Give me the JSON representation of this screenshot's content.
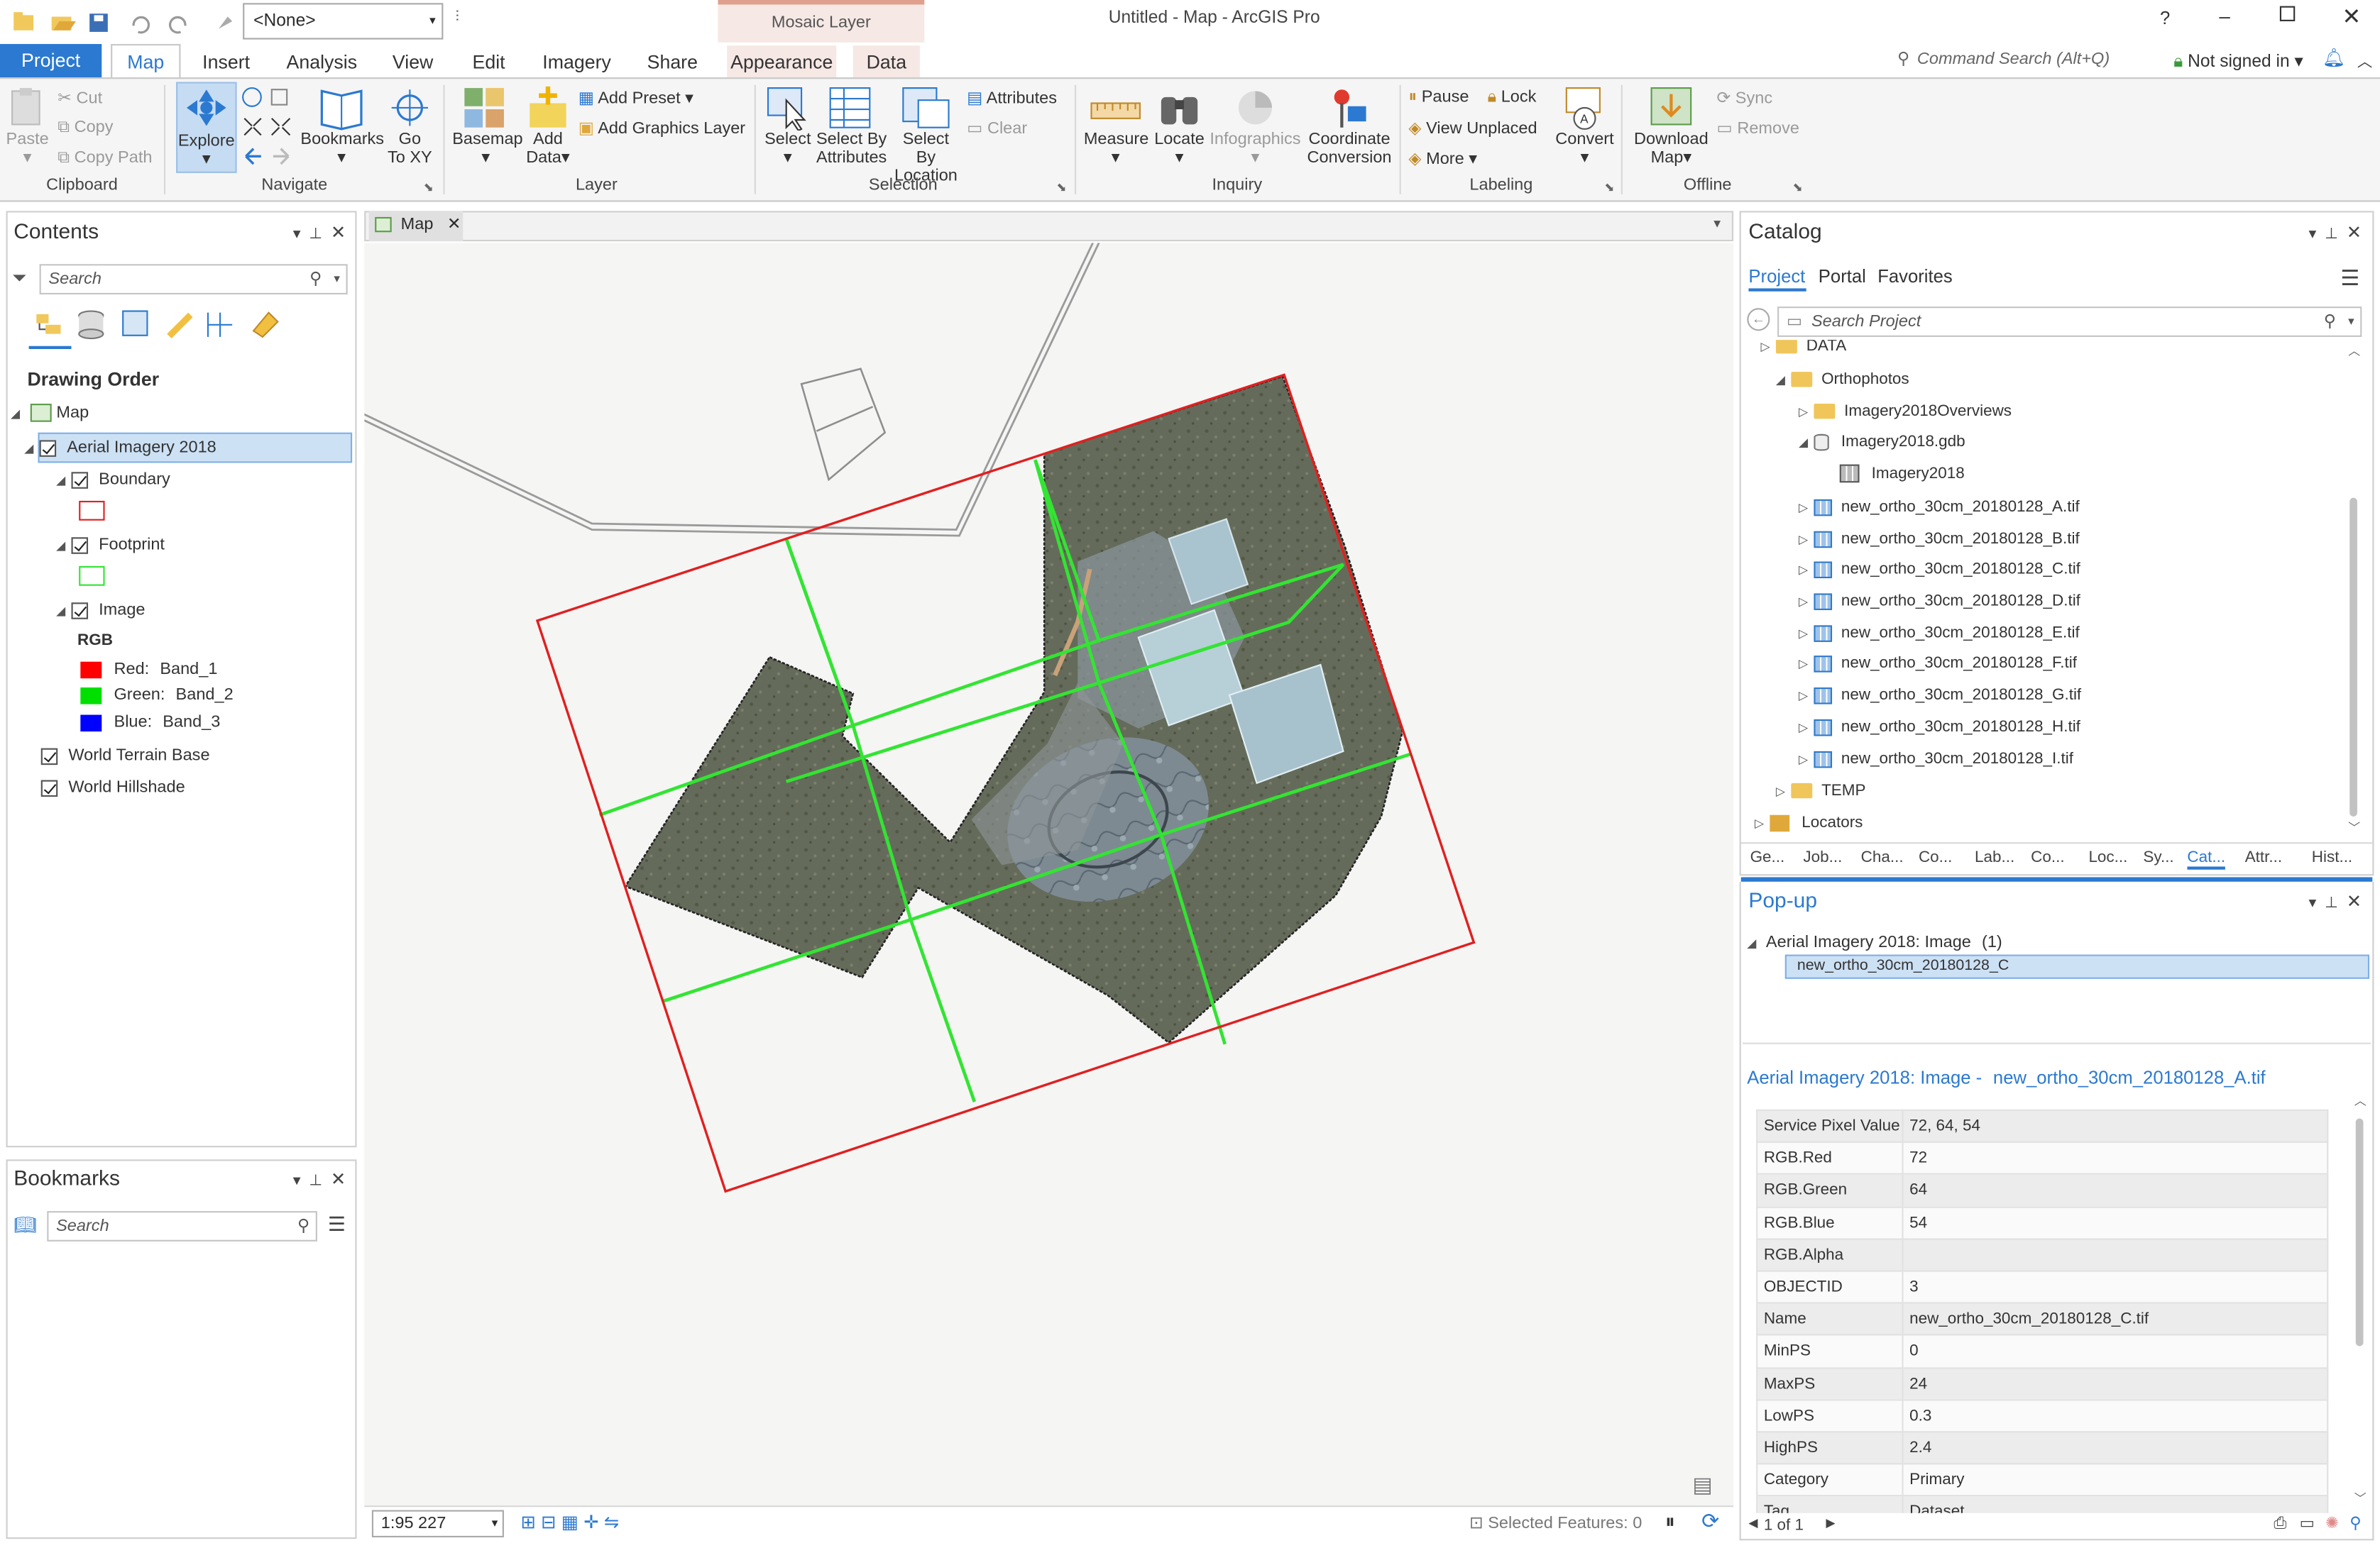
{
  "app": {
    "title": "Untitled - Map - ArcGIS Pro",
    "help": "?",
    "context_tab": "Mosaic Layer",
    "layer_select": "<None>",
    "command_search": "Command Search (Alt+Q)",
    "sign_in": "Not signed in"
  },
  "tabs": [
    "Project",
    "Map",
    "Insert",
    "Analysis",
    "View",
    "Edit",
    "Imagery",
    "Share",
    "Appearance",
    "Data"
  ],
  "ribbon": {
    "clipboard": {
      "label": "Clipboard",
      "paste": "Paste",
      "cut": "Cut",
      "copy": "Copy",
      "copy_path": "Copy Path"
    },
    "navigate": {
      "label": "Navigate",
      "explore": "Explore",
      "bookmarks": "Bookmarks",
      "goto1": "Go",
      "goto2": "To XY"
    },
    "layer": {
      "label": "Layer",
      "basemap": "Basemap",
      "add_data1": "Add",
      "add_data2": "Data",
      "add_preset": "Add Preset",
      "add_graphics": "Add Graphics Layer"
    },
    "selection": {
      "label": "Selection",
      "select": "Select",
      "sba1": "Select By",
      "sba2": "Attributes",
      "sbl1": "Select By",
      "sbl2": "Location",
      "attributes": "Attributes",
      "clear": "Clear"
    },
    "inquiry": {
      "label": "Inquiry",
      "measure": "Measure",
      "locate": "Locate",
      "infographics": "Infographics",
      "cc1": "Coordinate",
      "cc2": "Conversion"
    },
    "labeling": {
      "label": "Labeling",
      "pause": "Pause",
      "lock": "Lock",
      "view_unplaced": "View Unplaced",
      "more": "More",
      "convert": "Convert"
    },
    "offline": {
      "label": "Offline",
      "dl1": "Download",
      "dl2": "Map",
      "sync": "Sync",
      "remove": "Remove"
    }
  },
  "contents": {
    "title": "Contents",
    "search_placeholder": "Search",
    "drawing_order": "Drawing Order",
    "map": "Map",
    "layer": "Aerial Imagery 2018",
    "boundary": "Boundary",
    "footprint": "Footprint",
    "image": "Image",
    "rgb": "RGB",
    "red": "Red:",
    "red_band": "Band_1",
    "green": "Green:",
    "green_band": "Band_2",
    "blue": "Blue:",
    "blue_band": "Band_3",
    "terrain": "World Terrain Base",
    "hillshade": "World Hillshade"
  },
  "bookmarks": {
    "title": "Bookmarks",
    "search_placeholder": "Search"
  },
  "map_view": {
    "tab": "Map",
    "scale": "1:95 227",
    "selected_features": "Selected Features: 0"
  },
  "catalog": {
    "title": "Catalog",
    "tabs": [
      "Project",
      "Portal",
      "Favorites"
    ],
    "search_placeholder": "Search Project",
    "items": {
      "data": "DATA",
      "orthophotos": "Orthophotos",
      "overviews": "Imagery2018Overviews",
      "gdb": "Imagery2018.gdb",
      "mosaic": "Imagery2018",
      "temp": "TEMP",
      "locators": "Locators"
    },
    "tifs": [
      "new_ortho_30cm_20180128_A.tif",
      "new_ortho_30cm_20180128_B.tif",
      "new_ortho_30cm_20180128_C.tif",
      "new_ortho_30cm_20180128_D.tif",
      "new_ortho_30cm_20180128_E.tif",
      "new_ortho_30cm_20180128_F.tif",
      "new_ortho_30cm_20180128_G.tif",
      "new_ortho_30cm_20180128_H.tif",
      "new_ortho_30cm_20180128_I.tif"
    ],
    "bottom_tabs": [
      "Ge...",
      "Job...",
      "Cha...",
      "Co...",
      "Lab...",
      "Co...",
      "Loc...",
      "Sy...",
      "Cat...",
      "Attr...",
      "Hist..."
    ]
  },
  "popup": {
    "title": "Pop-up",
    "group": "Aerial Imagery 2018: Image",
    "group_count": "(1)",
    "selected_item": "new_ortho_30cm_20180128_C",
    "header_prefix": "Aerial Imagery 2018: Image -",
    "header_link": "new_ortho_30cm_20180128_A.tif",
    "rows": [
      {
        "k": "Service Pixel Value",
        "v": "72, 64, 54"
      },
      {
        "k": "RGB.Red",
        "v": "72"
      },
      {
        "k": "RGB.Green",
        "v": "64"
      },
      {
        "k": "RGB.Blue",
        "v": "54"
      },
      {
        "k": "RGB.Alpha",
        "v": ""
      },
      {
        "k": "OBJECTID",
        "v": "3"
      },
      {
        "k": "Name",
        "v": "new_ortho_30cm_20180128_C.tif"
      },
      {
        "k": "MinPS",
        "v": "0"
      },
      {
        "k": "MaxPS",
        "v": "24"
      },
      {
        "k": "LowPS",
        "v": "0.3"
      },
      {
        "k": "HighPS",
        "v": "2.4"
      },
      {
        "k": "Category",
        "v": "Primary"
      }
    ],
    "cut_row": {
      "k": "Tag",
      "v": "Dataset"
    },
    "pager": "1 of 1"
  },
  "colors": {
    "accent": "#2b79d0",
    "boundary": "#e02020",
    "footprint": "#33e433",
    "band_red": "#ff0000",
    "band_green": "#00e000",
    "band_blue": "#0000ff"
  }
}
